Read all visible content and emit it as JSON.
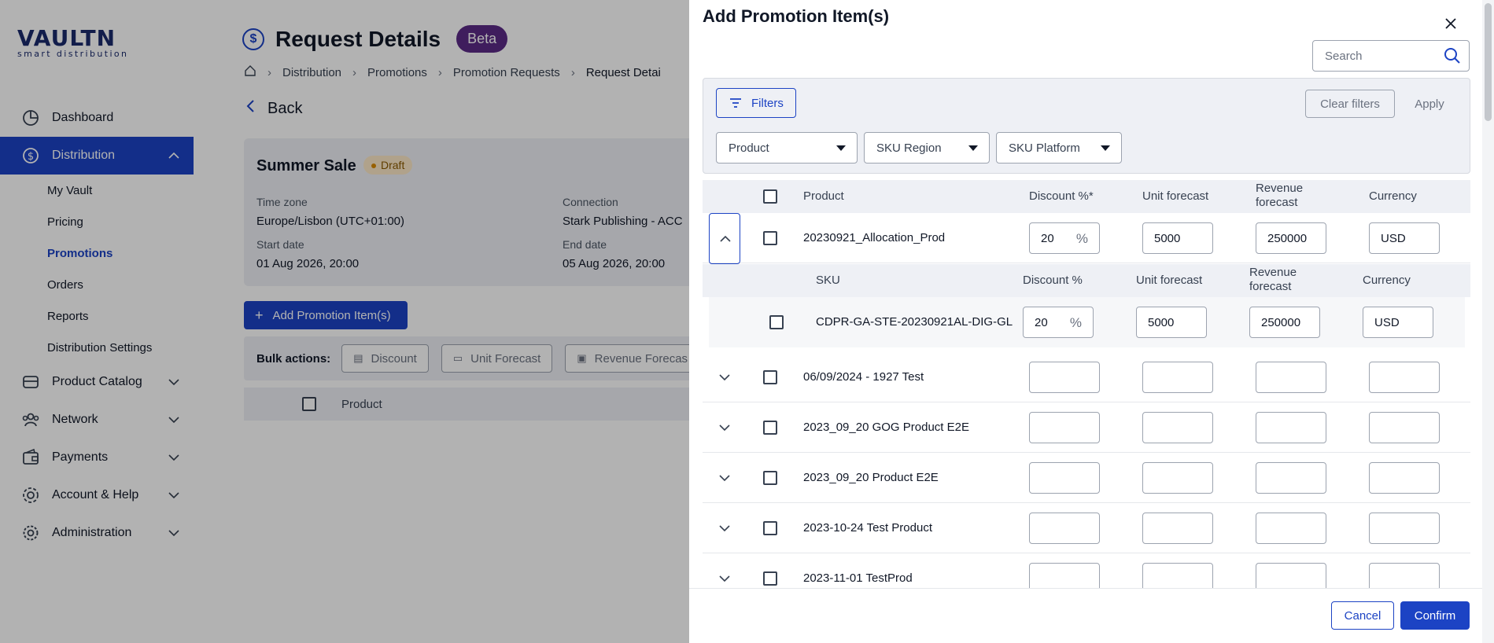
{
  "logo": {
    "main": "VAULTN",
    "sub": "smart distribution"
  },
  "sidebar": {
    "dashboard": "Dashboard",
    "distribution": "Distribution",
    "sub": [
      "My Vault",
      "Pricing",
      "Promotions",
      "Orders",
      "Reports",
      "Distribution Settings"
    ],
    "product_catalog": "Product Catalog",
    "network": "Network",
    "payments": "Payments",
    "account_help": "Account & Help",
    "administration": "Administration"
  },
  "page": {
    "title": "Request Details",
    "beta": "Beta",
    "breadcrumb": [
      "Distribution",
      "Promotions",
      "Promotion Requests",
      "Request Detai"
    ],
    "back": "Back"
  },
  "summary": {
    "name": "Summer Sale",
    "status": "Draft",
    "time_zone_label": "Time zone",
    "time_zone": "Europe/Lisbon (UTC+01:00)",
    "connection_label": "Connection",
    "connection": "Stark Publishing - ACC",
    "start_label": "Start date",
    "start": "01 Aug 2026, 20:00",
    "end_label": "End date",
    "end": "05 Aug 2026, 20:00"
  },
  "actions": {
    "add_item": "Add Promotion Item(s)",
    "bulk_label": "Bulk actions:",
    "bulk": [
      "Discount",
      "Unit Forecast",
      "Revenue Forecas"
    ],
    "table_product": "Product"
  },
  "modal": {
    "title": "Add Promotion Item(s)",
    "search_placeholder": "Search",
    "filters": "Filters",
    "clear_filters": "Clear filters",
    "apply": "Apply",
    "selects": [
      "Product",
      "SKU Region",
      "SKU Platform"
    ],
    "columns": [
      "Product",
      "Discount %*",
      "Unit forecast",
      "Revenue forecast",
      "Currency"
    ],
    "sub_columns": [
      "SKU",
      "Discount %",
      "Unit forecast",
      "Revenue forecast",
      "Currency"
    ],
    "percent_sign": "%",
    "expanded_row": {
      "name": "20230921_Allocation_Prod",
      "discount": "20",
      "unit": "5000",
      "revenue": "250000",
      "currency": "USD"
    },
    "sku_row": {
      "sku": "CDPR-GA-STE-20230921AL-DIG-GL",
      "discount": "20",
      "unit": "5000",
      "revenue": "250000",
      "currency": "USD"
    },
    "rows": [
      "06/09/2024 - 1927 Test",
      "2023_09_20 GOG Product E2E",
      "2023_09_20 Product E2E",
      "2023-10-24 Test Product",
      "2023-11-01 TestProd"
    ],
    "cancel": "Cancel",
    "confirm": "Confirm"
  },
  "colors": {
    "primary": "#1c43c4",
    "beta": "#5b2a86",
    "panel": "#eef0f5"
  }
}
